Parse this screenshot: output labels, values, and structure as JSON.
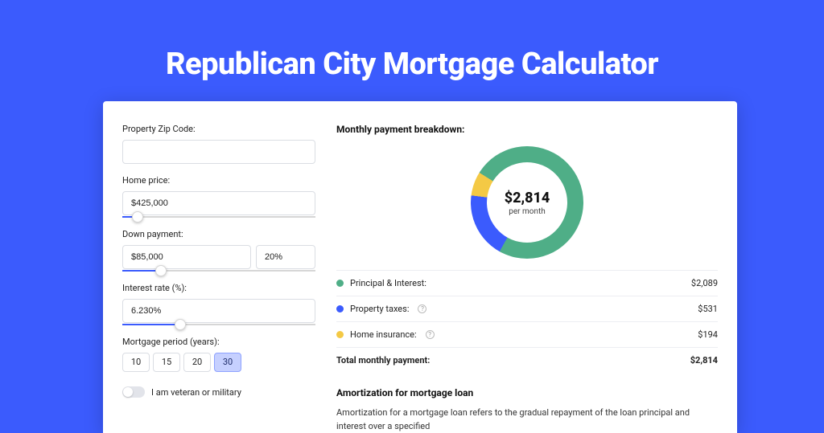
{
  "title": "Republican City Mortgage Calculator",
  "form": {
    "zip_label": "Property Zip Code:",
    "zip_value": "",
    "price_label": "Home price:",
    "price_value": "$425,000",
    "price_slider_pct": 8,
    "dp_label": "Down payment:",
    "dp_value": "$85,000",
    "dp_pct_value": "20%",
    "dp_slider_pct": 20,
    "rate_label": "Interest rate (%):",
    "rate_value": "6.230%",
    "rate_slider_pct": 30,
    "period_label": "Mortgage period (years):",
    "period_options": [
      "10",
      "15",
      "20",
      "30"
    ],
    "period_active": "30",
    "veteran_label": "I am veteran or military"
  },
  "breakdown": {
    "title": "Monthly payment breakdown:",
    "center_amount": "$2,814",
    "center_sub": "per month",
    "rows": [
      {
        "label": "Principal & Interest:",
        "value": "$2,089",
        "color": "green",
        "help": false
      },
      {
        "label": "Property taxes:",
        "value": "$531",
        "color": "blue",
        "help": true
      },
      {
        "label": "Home insurance:",
        "value": "$194",
        "color": "yellow",
        "help": true
      }
    ],
    "total_label": "Total monthly payment:",
    "total_value": "$2,814"
  },
  "chart_data": {
    "type": "pie",
    "title": "Monthly payment breakdown",
    "series": [
      {
        "name": "Principal & Interest",
        "value": 2089,
        "color": "#4fae87"
      },
      {
        "name": "Property taxes",
        "value": 531,
        "color": "#3b5bfd"
      },
      {
        "name": "Home insurance",
        "value": 194,
        "color": "#f4c945"
      }
    ],
    "total": 2814,
    "center_label": "$2,814 per month"
  },
  "amort": {
    "title": "Amortization for mortgage loan",
    "text": "Amortization for a mortgage loan refers to the gradual repayment of the loan principal and interest over a specified"
  },
  "colors": {
    "accent": "#3b5bfd",
    "green": "#4fae87",
    "yellow": "#f4c945"
  }
}
